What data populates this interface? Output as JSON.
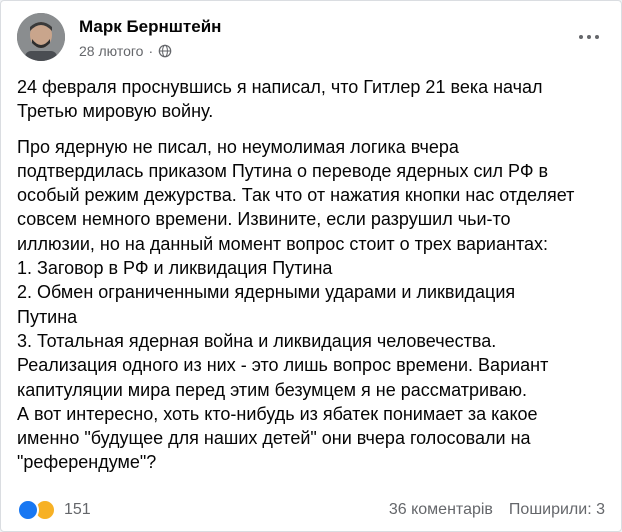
{
  "post": {
    "author": "Марк Бернштейн",
    "date": "28 лютого",
    "paragraphs": [
      "24 февраля проснувшись я написал, что Гитлер 21 века начал\nТретью мировую войну.",
      "Про ядерную не писал, но неумолимая логика вчера\nподтвердилась приказом Путина о переводе ядерных сил РФ в\nособый режим дежурства. Так что от нажатия кнопки нас отделяет\nсовсем немного времени. Извините, если разрушил чьи-то\nиллюзии, но на данный момент вопрос стоит о трех вариантах:\n1. Заговор в РФ и ликвидация Путина\n2. Обмен ограниченными ядерными ударами и ликвидация\nПутина\n3. Тотальная ядерная война и ликвидация человечества.\nРеализация одного из них - это лишь вопрос времени. Вариант\nкапитуляции мира перед этим безумцем я не рассматриваю.\nА вот интересно, хоть кто-нибудь из ябатек понимает за какое\nименно \"будущее для наших детей\" они вчера голосовали на\n\"референдуме\"?"
    ]
  },
  "footer": {
    "reaction_count": "151",
    "comments": "36 коментарів",
    "shares": "Поширили: 3"
  },
  "colors": {
    "like": "#1877f2",
    "sad": "#f7b125",
    "muted_text": "#65676b"
  },
  "icons": {
    "privacy": "globe-icon",
    "menu": "more-options-icon"
  }
}
